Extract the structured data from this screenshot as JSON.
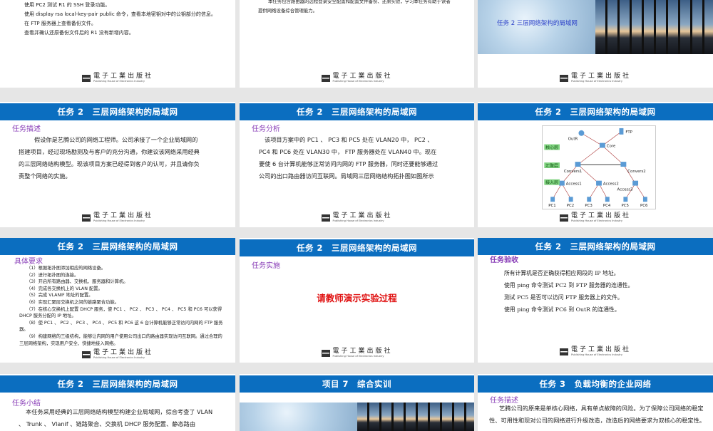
{
  "publisher": {
    "cn": "電子工業出版社",
    "en": "Publishing House of Electronics Industry"
  },
  "colors": {
    "header": "#0b6ec0",
    "section": "#8a3fb8",
    "emphasis": "#e01010"
  },
  "slides": [
    {
      "lines": [
        "使用 PC2 测试 R1 的 SSH 登录功能。",
        "使用 display rsa local-key-pair public 命令，查看本地密钥对中的公钥部分的信息。",
        "在 FTP 服务器上查看备份文件。",
        "查看并确认还原备份文件后的 R1 没有新增内容。"
      ]
    },
    {
      "lines": [
        "本任务包含路由器的远程登录安全配置和配置文件备份、还原实验，学习本任务有助于读者提供网络设备综合管理能力。"
      ]
    },
    {
      "image_title": "任务 2  三层网络架构的局域网"
    },
    {
      "title": "任务 2　三层网络架构的局域网",
      "section": "任务描述",
      "text": "假设你是艺腾公司的网络工程师。公司承接了一个企业局域网的搭建项目，经过现场勘测及与客户的充分沟通，你建议该网络采用经典的三层网络结构模型。现该项目方案已经得到客户的认可，并且请你负责整个网络的实施。"
    },
    {
      "title": "任务 2　三层网络架构的局域网",
      "section": "任务分析",
      "text": "该项目方案中的 PC1 、 PC3 和 PC5 处在 VLAN20 中， PC2 、 PC4 和 PC6 处在 VLAN30 中， FTP 服务器处在 VLAN40 中。现在要使 6 台计算机能够正常访问内网的 FTP 服务器，同时还要能够通过公司的出口路由器访问互联网。局域网三层网络结构拓扑图如图所示"
    },
    {
      "title": "任务 2　三层网络架构的局域网",
      "diagram": {
        "layers": [
          "核心层",
          "汇聚层",
          "接入层"
        ],
        "nodes": [
          "OutR",
          "FTP",
          "Core",
          "Convers1",
          "Convers2",
          "Access1",
          "Access2",
          "Access3",
          "PC1",
          "PC2",
          "PC3",
          "PC4",
          "PC5",
          "PC6"
        ]
      }
    },
    {
      "title": "任务 2　三层网络架构的局域网",
      "section": "具体要求",
      "items": [
        "（1）根据拓扑图添加相应的网络设备。",
        "（2）进行拓扑图的连接。",
        "（3）开启所有路由器、交换机、服务器和计算机。",
        "（4）完成各交换机上的 VLAN 配置。",
        "（5）完成 VLANIF 地址的配置。",
        "（6）实现汇聚层交换机之间的链路聚合功能。",
        "（7）在核心交换机上配置 DHCP 服务，使 PC1 、 PC2 、 PC3 、 PC4 、 PC5 和 PC6 可以获得 DHCP 服务分配的 IP 地址。",
        "（8）使 PC1 、 PC2 、 PC3 、 PC4 、 PC5 和 PC6 这 6 台计算机能够正常访问内网的 FTP 服务器。",
        "（9）构建网络的三级结构，能够让内网的用户使用公司出口的路由器实现访问互联网。通过合理的三层网络架构，实现用户安全、快捷地接入网络。"
      ]
    },
    {
      "title": "任务 2　三层网络架构的局域网",
      "section": "任务实施",
      "emphasis": "请教师演示实验过程"
    },
    {
      "title": "任务 2　三层网络架构的局域网",
      "section": "任务验收",
      "items": [
        "所有计算机是否正确获得相应网段的 IP 地址。",
        "使用 ping 命令测试 PC2 到 FTP 服务器的连通性。",
        "测试 PC5 是否可以访问 FTP 服务器上的文件。",
        "使用 ping 命令测试 PC6 到 OutR 的连通性。"
      ]
    },
    {
      "title": "任务 2　三层网络架构的局域网",
      "section": "任务小结",
      "text": "本任务采用经典的三层网络结构模型构建企业局域网，综合考查了 VLAN 、 Trunk 、 Vlanif 、链路聚合、交换机 DHCP 服务配置、静态路由"
    },
    {
      "title": "项目 7　综合实训"
    },
    {
      "title": "任务 3　负载均衡的企业网络",
      "section": "任务描述",
      "text": "艺腾公司的原来是单核心网络，具有单点故障的风险。为了保障公司网络的稳定性、可用性和现对公司的网络进行升级改造，改造后的网络要求为双核心的稳定性。"
    }
  ]
}
